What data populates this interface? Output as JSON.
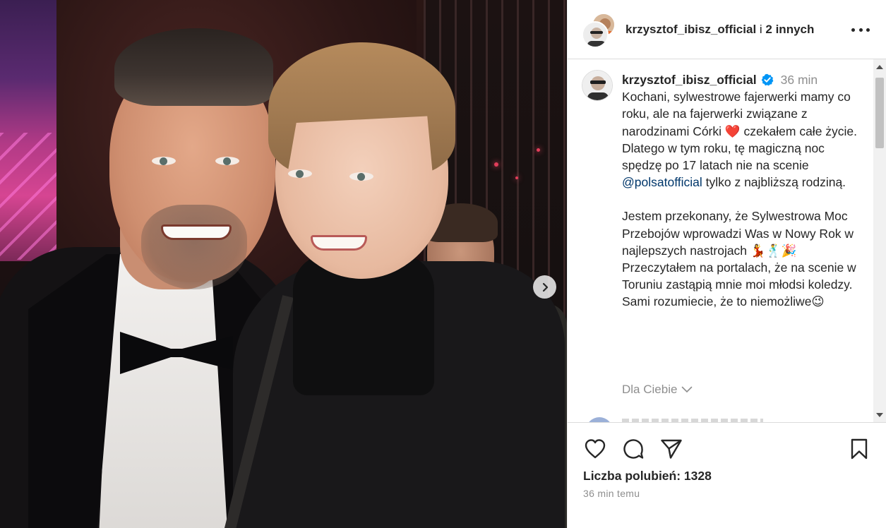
{
  "header": {
    "username": "krzysztof_ibisz_official",
    "separator": " i ",
    "others": "2 innych"
  },
  "caption": {
    "username": "krzysztof_ibisz_official",
    "time": "36 min",
    "line1_before_heart": "Kochani, sylwestrowe fajerwerki mamy co roku, ale na fajerwerki związane z narodzinami Córki ",
    "heart": "❤️",
    "line1_after_heart": " czekałem całe życie. Dlatego w tym roku, tę magiczną noc spędzę po 17 latach nie na scenie ",
    "mention": "@polsatofficial",
    "line1_end": " tylko z najbliższą rodziną.",
    "para2": "Jestem przekonany, że Sylwestrowa Moc Przebojów wprowadzi Was w Nowy Rok w najlepszych nastrojach 💃🕺🎉",
    "para3": "Przeczytałem na portalach, że na scenie w Toruniu zastąpią mnie moi młodsi koledzy. Sami rozumiecie, że to niemożliwe😉"
  },
  "dla_ciebie": "Dla Ciebie",
  "likes_label": "Liczba polubień: 1328",
  "time_ago": "36 min temu",
  "icons": {
    "like": "heart-icon",
    "comment": "comment-icon",
    "share": "paper-plane-icon",
    "save": "bookmark-icon",
    "more": "more-icon",
    "next": "chevron-right-icon",
    "verified": "verified-badge-icon"
  },
  "colors": {
    "verified": "#0095f6",
    "mention": "#00376b",
    "muted": "#8e8e8e",
    "text": "#262626"
  }
}
